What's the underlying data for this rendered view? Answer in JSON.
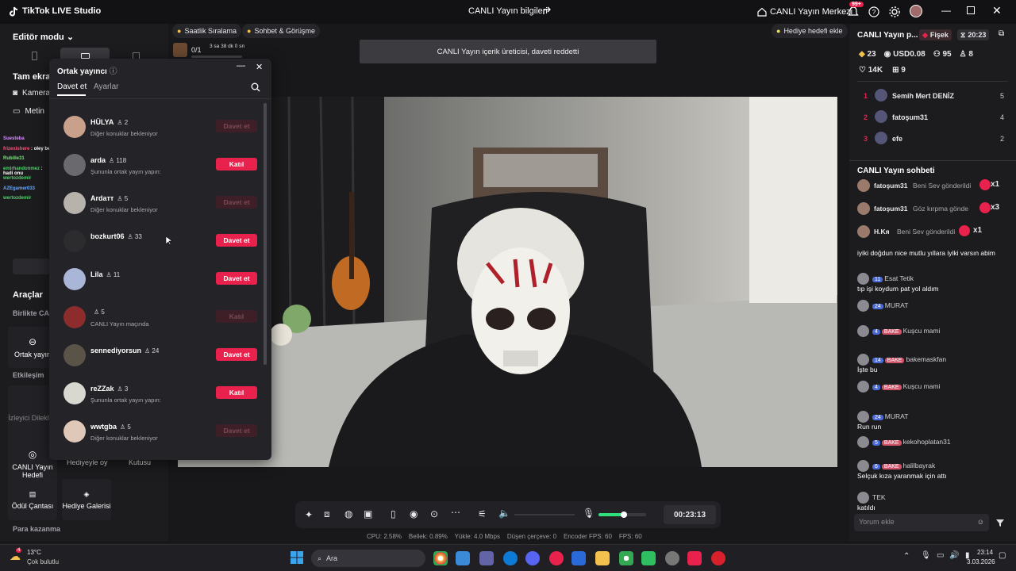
{
  "titlebar": {
    "app_name": "TikTok LIVE Studio",
    "center_title": "CANLI Yayın bilgileri",
    "live_center": "CANLI Yayın Merkezi",
    "notif_count": "99+"
  },
  "left": {
    "editor_mode": "Editör modu",
    "fullscreen": "Tam ekran",
    "camera": "Kamera",
    "text": "Metin",
    "tools_title": "Araçlar",
    "together_live": "Birlikte CAN",
    "cohost": "Ortak yayın",
    "interaction": "Etkileşim",
    "viewer_wishes": "İzleyici Dilekleri",
    "live_goal": "CANLI Yayın Hedefi",
    "gift_by": "Hediyeyle oy",
    "box": "Kutusu",
    "reward_bag": "Ödül Çantası",
    "gift_gallery": "Hediye Galerisi",
    "earn": "Para kazanma"
  },
  "mini_chat": [
    {
      "name": "Suesteba",
      "color": "#d78cff"
    },
    {
      "name": "frizexishere",
      "text": "oley be",
      "color": "#ff4f7a"
    },
    {
      "name": "Rubille31",
      "color": "#7fe37f"
    },
    {
      "name": "emirhandonmez",
      "text": "hadi onu",
      "color": "#4fd16a"
    },
    {
      "name": "wertozdemir",
      "color": "#4fd16a"
    },
    {
      "name": "AZEgamer033",
      "color": "#6aa8ff"
    },
    {
      "name": "wertozdemir",
      "color": "#4fd16a"
    }
  ],
  "top_tabs": {
    "hourly": "Saatlik Sıralama",
    "chat_meet": "Sohbet & Görüşme",
    "counter": "0/1",
    "timer": "3 sa 38 dk 0 sn",
    "gift_goal": "Hediye hedefi ekle"
  },
  "toast": "CANLI Yayın içerik üreticisi, daveti reddetti",
  "popup": {
    "title": "Ortak yayıncı",
    "tab_invite": "Davet et",
    "tab_settings": "Ayarlar",
    "rows": [
      {
        "name": "HÜLYA",
        "count": "2",
        "sub": "Diğer konuklar bekleniyor",
        "button": "Davet et",
        "active": false,
        "av": "#c9a08c"
      },
      {
        "name": "arda",
        "count": "118",
        "sub": "Şununla ortak yayın yapın:",
        "button": "Katıl",
        "active": true,
        "av": "#6a6a6e"
      },
      {
        "name": "Ardaтт",
        "count": "5",
        "sub": "Diğer konuklar bekleniyor",
        "button": "Davet et",
        "active": false,
        "av": "#b7b2ac"
      },
      {
        "name": "bozkurt06",
        "count": "33",
        "sub": "",
        "button": "Davet et",
        "active": true,
        "av": "#2c2c2e"
      },
      {
        "name": "Lila",
        "count": "11",
        "sub": "",
        "button": "Davet et",
        "active": true,
        "av": "#a9b6d8"
      },
      {
        "name": "",
        "count": "5",
        "sub": "CANLI Yayın maçında",
        "button": "Katıl",
        "active": false,
        "av": "#8c2c2c"
      },
      {
        "name": "sennediyorsun",
        "count": "24",
        "sub": "",
        "button": "Davet et",
        "active": true,
        "av": "#5a5448"
      },
      {
        "name": "reZZak",
        "count": "3",
        "sub": "Şununla ortak yayın yapın:",
        "button": "Katıl",
        "active": true,
        "av": "#d8d8d0"
      },
      {
        "name": "wwtgba",
        "count": "5",
        "sub": "Diğer konuklar bekleniyor",
        "button": "Davet et",
        "active": false,
        "av": "#e0c8b8"
      }
    ]
  },
  "right": {
    "title": "CANLI Yayın p...",
    "fisek": "Fişek",
    "time": "20:23",
    "coins": "23",
    "usd": "USD0.08",
    "viewers": "95",
    "users": "8",
    "likes": "14K",
    "gifts": "9",
    "rank": [
      {
        "pos": "1",
        "name": "Semih Mert DENİZ",
        "score": "5"
      },
      {
        "pos": "2",
        "name": "fatoşum31",
        "score": "4"
      },
      {
        "pos": "3",
        "name": "efe",
        "score": "2"
      }
    ],
    "chat_title": "CANLI Yayın sohbeti",
    "gift_events": [
      {
        "name": "fatoşum31",
        "action": "Beni Sev gönderildi",
        "mult": "x1"
      },
      {
        "name": "fatoşum31",
        "action": "Göz kırpma gönde",
        "mult": "x3"
      },
      {
        "name": "H.Kя",
        "action": "Beni Sev gönderildi",
        "mult": "x1"
      }
    ],
    "messages": [
      {
        "badges": [],
        "name": "",
        "text": "iyiki doğdun nice mutlu yıllara iyiki varsın abim"
      },
      {
        "badges": [
          "11"
        ],
        "name": "Esat Tetik",
        "text": "tıp işi koydum pat yol aldım"
      },
      {
        "badges": [
          "24"
        ],
        "name": "MURAT",
        "text": ""
      },
      {
        "badges": [
          "4",
          "BAKE"
        ],
        "name": "Kuşcu mami",
        "text": ""
      },
      {
        "badges": [
          "14",
          "BAKE"
        ],
        "name": "bakemaskfan",
        "text": "İşte bu"
      },
      {
        "badges": [
          "4",
          "BAKE"
        ],
        "name": "Kuşcu mami",
        "text": ""
      },
      {
        "badges": [
          "24"
        ],
        "name": "MURAT",
        "text": "Run run"
      },
      {
        "badges": [
          "5",
          "BAKE"
        ],
        "name": "kekohoplatan31",
        "text": ""
      },
      {
        "badges": [
          "6",
          "BAKE"
        ],
        "name": "halilbayrak",
        "text": "Selçuk kıza yaranmak için attı"
      },
      {
        "badges": [],
        "name": "TEK",
        "text": "katıldı"
      }
    ],
    "comment_placeholder": "Yorum ekle"
  },
  "controls": {
    "timer": "00:23:13"
  },
  "stats": {
    "cpu": "CPU: 2.58%",
    "mem": "Bellek: 0.89%",
    "upload": "Yükle: 4.0 Mbps",
    "dropped": "Düşen çerçeve: 0",
    "encoder": "Encoder FPS: 60",
    "fps": "FPS: 60"
  },
  "taskbar": {
    "temp": "13°C",
    "weather": "Çok bulutlu",
    "search": "Ara",
    "time": "23:14",
    "date": "3.03.2026",
    "weather_badge": "4"
  }
}
